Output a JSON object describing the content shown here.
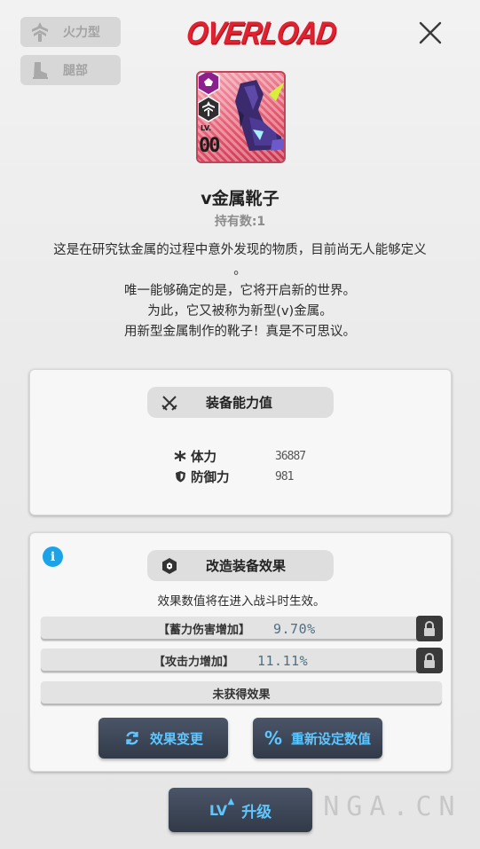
{
  "header": {
    "brand": "OVERLOAD",
    "type_tag": "火力型",
    "slot_tag": "腿部"
  },
  "item": {
    "lv_label": "LV.",
    "lv_value": "00",
    "name": "v金属靴子",
    "owned": "持有数:1",
    "description": [
      "这是在研究钛金属的过程中意外发现的物质，目前尚无人能够定义",
      "。",
      "唯一能够确定的是，它将开启新的世界。",
      "为此，它又被称为新型(v)金属。",
      "用新型金属制作的靴子！真是不可思议。"
    ]
  },
  "stats_panel": {
    "title": "装备能力值",
    "stats": [
      {
        "label": "体力",
        "value": "36887",
        "icon": "asterisk-icon"
      },
      {
        "label": "防御力",
        "value": "981",
        "icon": "shield-icon"
      }
    ]
  },
  "mod_panel": {
    "title": "改造装备效果",
    "note": "效果数值将在进入战斗时生效。",
    "effects": [
      {
        "label": "【蓄力伤害增加】",
        "value": "9.70%",
        "locked": true
      },
      {
        "label": "【攻击力增加】",
        "value": "11.11%",
        "locked": true
      }
    ],
    "empty_effect": "未获得效果",
    "change_button": "效果变更",
    "reset_button": "重新设定数值"
  },
  "footer": {
    "upgrade_prefix": "LV",
    "upgrade_label": "升级"
  },
  "watermark": {
    "text": "BBS.NGA.CN"
  },
  "colors": {
    "brand": "#e0212f",
    "accent": "#5fc6ff",
    "info": "#1aa3e8",
    "button_bg": "#3a4352",
    "card_bg": "#e2566d",
    "effect_value": "#4d6f86"
  }
}
